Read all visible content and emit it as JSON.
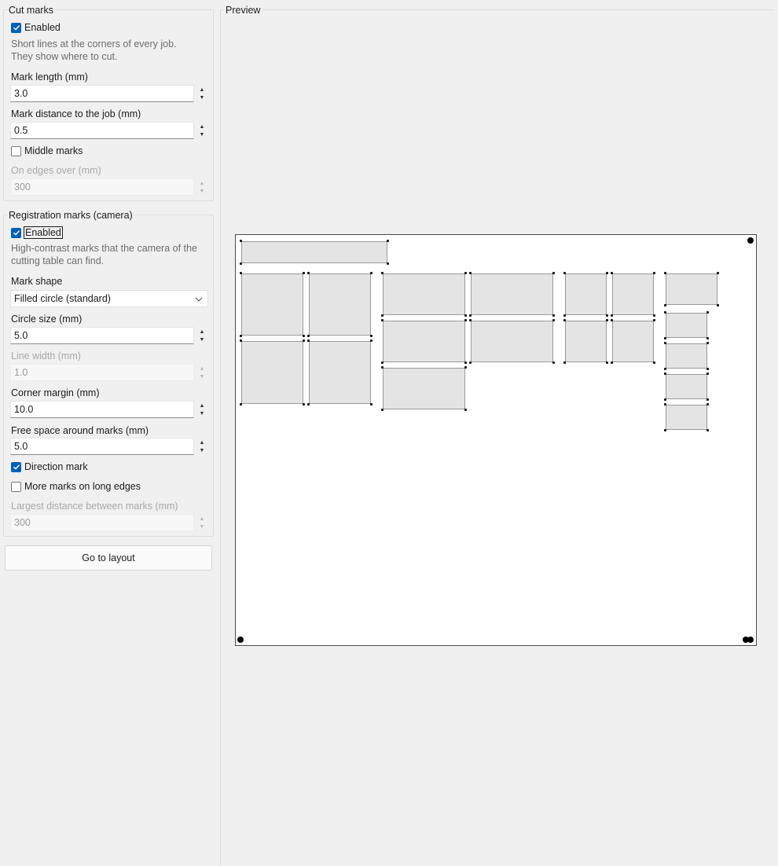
{
  "cut_marks": {
    "title": "Cut marks",
    "enabled_label": "Enabled",
    "enabled": true,
    "description": "Short lines at the corners of every job. They show where to cut.",
    "mark_length_label": "Mark length (mm)",
    "mark_length_value": "3.0",
    "mark_distance_label": "Mark distance to the job (mm)",
    "mark_distance_value": "0.5",
    "middle_marks_label": "Middle marks",
    "middle_marks": false,
    "edges_over_label": "On edges over (mm)",
    "edges_over_value": "300"
  },
  "registration_marks": {
    "title": "Registration marks (camera)",
    "enabled_label": "Enabled",
    "enabled": true,
    "description": "High-contrast marks that the camera of the cutting table can find.",
    "mark_shape_label": "Mark shape",
    "mark_shape_value": "Filled circle (standard)",
    "circle_size_label": "Circle size (mm)",
    "circle_size_value": "5.0",
    "line_width_label": "Line width (mm)",
    "line_width_value": "1.0",
    "corner_margin_label": "Corner margin (mm)",
    "corner_margin_value": "10.0",
    "free_space_label": "Free space around marks (mm)",
    "free_space_value": "5.0",
    "direction_mark_label": "Direction mark",
    "direction_mark": true,
    "more_marks_label": "More marks on long edges",
    "more_marks": false,
    "largest_distance_label": "Largest distance between marks (mm)",
    "largest_distance_value": "300"
  },
  "actions": {
    "go_to_layout_label": "Go to layout"
  },
  "preview": {
    "title": "Preview"
  },
  "icons": {
    "check": "checkmark-icon",
    "spin_up": "arrow-up-icon",
    "spin_down": "arrow-down-icon",
    "dropdown": "chevron-down-icon"
  },
  "colors": {
    "accent": "#005fb8",
    "job_fill": "#e4e4e4",
    "registration_mark": "#000000"
  }
}
